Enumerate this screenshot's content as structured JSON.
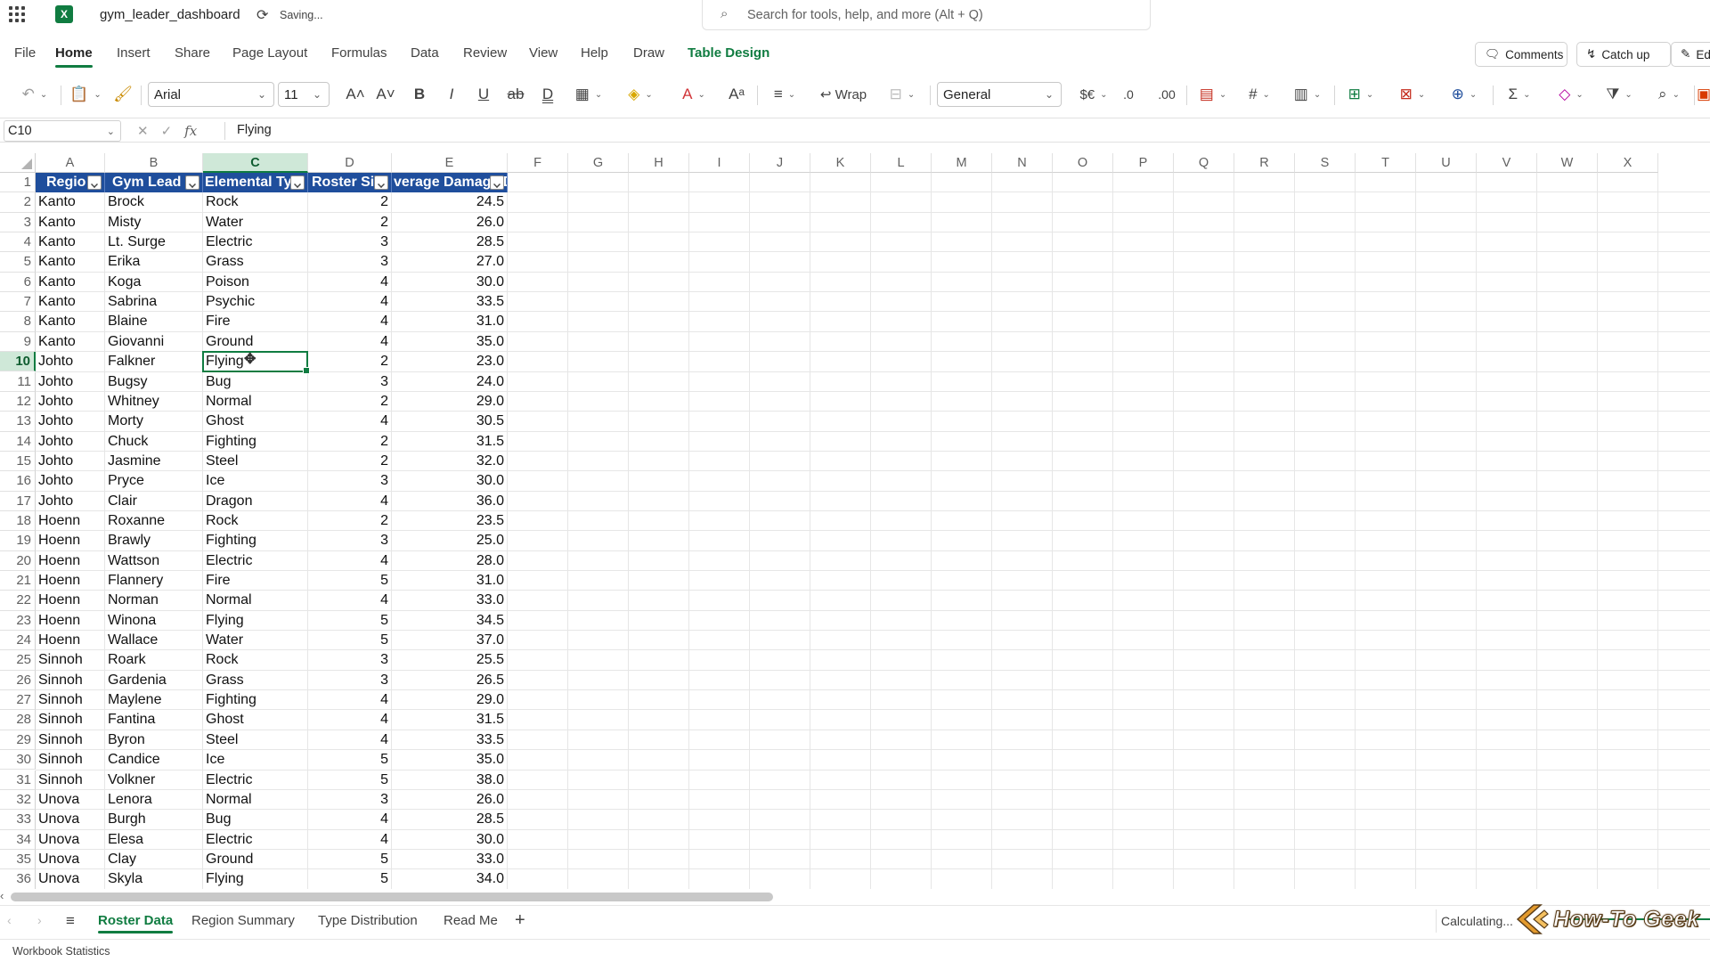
{
  "app": {
    "title": "gym_leader_dashboard",
    "saving_status": "Saving...",
    "search_placeholder": "Search for tools, help, and more (Alt + Q)",
    "brand_color": "#107c41",
    "logo_letter": "X"
  },
  "menu": {
    "tabs": [
      "File",
      "Home",
      "Insert",
      "Share",
      "Page Layout",
      "Formulas",
      "Data",
      "Review",
      "View",
      "Help",
      "Draw",
      "Table Design"
    ],
    "active": "Home",
    "comments_label": "Comments",
    "catchup_label": "Catch up",
    "edit_label": "Ed"
  },
  "ribbon": {
    "font_name": "Arial",
    "font_size": "11",
    "wrap_label": "Wrap",
    "number_format": "General",
    "currency_symbol": "$€"
  },
  "formula_bar": {
    "name_box": "C10",
    "fx_label": "fx",
    "content": "Flying"
  },
  "grid": {
    "column_letters": [
      "A",
      "B",
      "C",
      "D",
      "E",
      "F",
      "G",
      "H",
      "I",
      "J",
      "K",
      "L",
      "M",
      "N",
      "O",
      "P",
      "Q",
      "R",
      "S",
      "T",
      "U",
      "V",
      "W",
      "X"
    ],
    "selected_column": "C",
    "selected_row": "10",
    "table_header_color": "#1f4e9c",
    "headers": [
      "Regio",
      "Gym Lead",
      "Elemental Ty",
      "Roster Si",
      "verage Damage D"
    ],
    "rows": [
      [
        "Kanto",
        "Brock",
        "Rock",
        "2",
        "24.5"
      ],
      [
        "Kanto",
        "Misty",
        "Water",
        "2",
        "26.0"
      ],
      [
        "Kanto",
        "Lt. Surge",
        "Electric",
        "3",
        "28.5"
      ],
      [
        "Kanto",
        "Erika",
        "Grass",
        "3",
        "27.0"
      ],
      [
        "Kanto",
        "Koga",
        "Poison",
        "4",
        "30.0"
      ],
      [
        "Kanto",
        "Sabrina",
        "Psychic",
        "4",
        "33.5"
      ],
      [
        "Kanto",
        "Blaine",
        "Fire",
        "4",
        "31.0"
      ],
      [
        "Kanto",
        "Giovanni",
        "Ground",
        "4",
        "35.0"
      ],
      [
        "Johto",
        "Falkner",
        "Flying",
        "2",
        "23.0"
      ],
      [
        "Johto",
        "Bugsy",
        "Bug",
        "3",
        "24.0"
      ],
      [
        "Johto",
        "Whitney",
        "Normal",
        "2",
        "29.0"
      ],
      [
        "Johto",
        "Morty",
        "Ghost",
        "4",
        "30.5"
      ],
      [
        "Johto",
        "Chuck",
        "Fighting",
        "2",
        "31.5"
      ],
      [
        "Johto",
        "Jasmine",
        "Steel",
        "2",
        "32.0"
      ],
      [
        "Johto",
        "Pryce",
        "Ice",
        "3",
        "30.0"
      ],
      [
        "Johto",
        "Clair",
        "Dragon",
        "4",
        "36.0"
      ],
      [
        "Hoenn",
        "Roxanne",
        "Rock",
        "2",
        "23.5"
      ],
      [
        "Hoenn",
        "Brawly",
        "Fighting",
        "3",
        "25.0"
      ],
      [
        "Hoenn",
        "Wattson",
        "Electric",
        "4",
        "28.0"
      ],
      [
        "Hoenn",
        "Flannery",
        "Fire",
        "5",
        "31.0"
      ],
      [
        "Hoenn",
        "Norman",
        "Normal",
        "4",
        "33.0"
      ],
      [
        "Hoenn",
        "Winona",
        "Flying",
        "5",
        "34.5"
      ],
      [
        "Hoenn",
        "Wallace",
        "Water",
        "5",
        "37.0"
      ],
      [
        "Sinnoh",
        "Roark",
        "Rock",
        "3",
        "25.5"
      ],
      [
        "Sinnoh",
        "Gardenia",
        "Grass",
        "3",
        "26.5"
      ],
      [
        "Sinnoh",
        "Maylene",
        "Fighting",
        "4",
        "29.0"
      ],
      [
        "Sinnoh",
        "Fantina",
        "Ghost",
        "4",
        "31.5"
      ],
      [
        "Sinnoh",
        "Byron",
        "Steel",
        "4",
        "33.5"
      ],
      [
        "Sinnoh",
        "Candice",
        "Ice",
        "5",
        "35.0"
      ],
      [
        "Sinnoh",
        "Volkner",
        "Electric",
        "5",
        "38.0"
      ],
      [
        "Unova",
        "Lenora",
        "Normal",
        "3",
        "26.0"
      ],
      [
        "Unova",
        "Burgh",
        "Bug",
        "4",
        "28.5"
      ],
      [
        "Unova",
        "Elesa",
        "Electric",
        "4",
        "30.0"
      ],
      [
        "Unova",
        "Clay",
        "Ground",
        "5",
        "33.0"
      ],
      [
        "Unova",
        "Skyla",
        "Flying",
        "5",
        "34.0"
      ]
    ]
  },
  "sheets": {
    "tabs": [
      "Roster Data",
      "Region Summary",
      "Type Distribution",
      "Read Me"
    ],
    "active": "Roster Data",
    "add_label": "+"
  },
  "status": {
    "calculating": "Calculating...",
    "workbook_stats": "Workbook Statistics",
    "watermark": "How-To Geek"
  }
}
